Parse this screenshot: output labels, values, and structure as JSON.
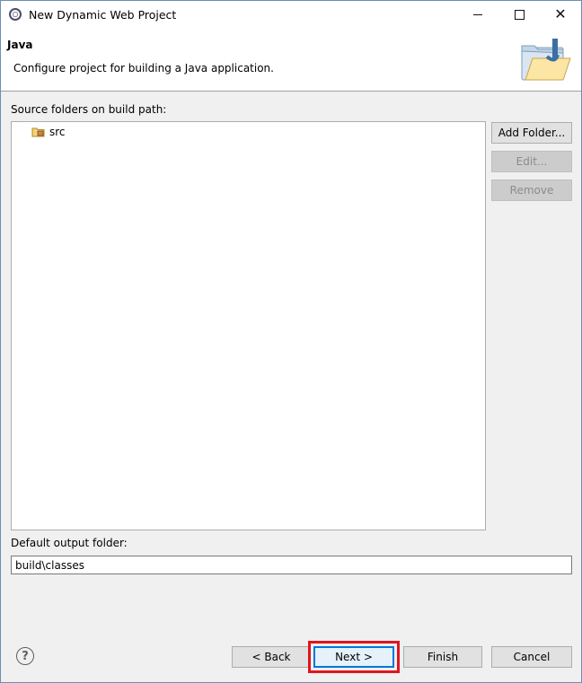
{
  "window": {
    "title": "New Dynamic Web Project",
    "controls": {
      "minimize": "minimize",
      "maximize": "maximize",
      "close": "✕"
    }
  },
  "banner": {
    "title": "Java",
    "description": "Configure project for building a Java application."
  },
  "source_folders": {
    "label": "Source folders on build path:",
    "items": [
      {
        "label": "src",
        "icon": "package-folder-icon"
      }
    ],
    "buttons": {
      "add": "Add Folder...",
      "edit": "Edit...",
      "remove": "Remove"
    }
  },
  "output_folder": {
    "label": "Default output folder:",
    "value": "build\\classes"
  },
  "footer": {
    "help": "?",
    "back": "< Back",
    "next": "Next >",
    "finish": "Finish",
    "cancel": "Cancel"
  },
  "colors": {
    "highlight": "#e0141e",
    "default_button_border": "#0078d7"
  }
}
